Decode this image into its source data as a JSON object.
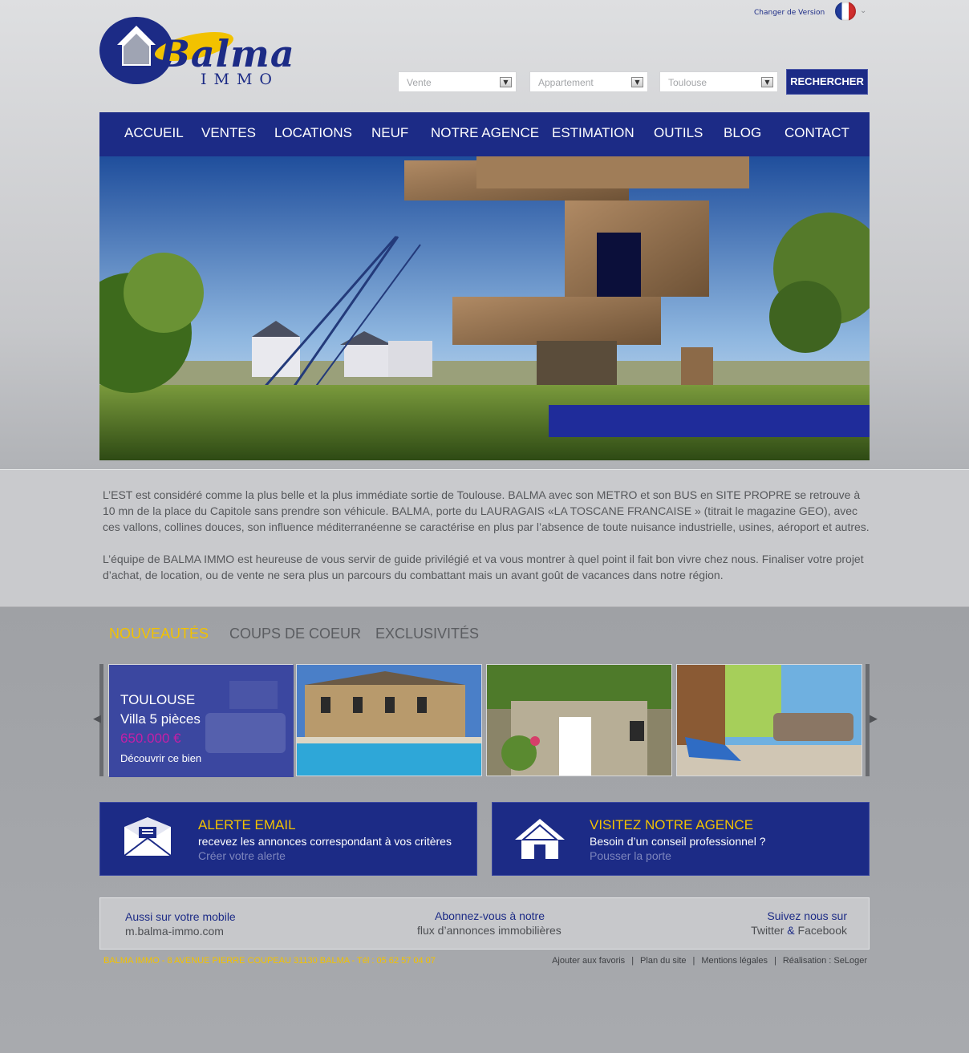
{
  "header": {
    "logo_title": "Balma",
    "logo_subtitle": "IMMO",
    "version_link": "Changer de Version"
  },
  "search": {
    "transaction": "Vente",
    "property_type": "Appartement",
    "city": "Toulouse",
    "button": "RECHERCHER"
  },
  "nav": [
    "ACCUEIL",
    "VENTES",
    "LOCATIONS",
    "NEUF",
    "NOTRE AGENCE",
    "ESTIMATION",
    "OUTILS",
    "BLOG",
    "CONTACT"
  ],
  "intro": {
    "p1": "L’EST est considéré comme la plus belle et la plus immédiate sortie de Toulouse. BALMA avec son METRO et son BUS en SITE PROPRE se retrouve à 10 mn de la place du Capitole sans prendre son véhicule. BALMA, porte du LAURAGAIS  «LA TOSCANE FRANCAISE » (titrait le magazine GEO), avec ces vallons, collines douces, son influence méditerranéenne se caractérise en plus par l’absence de toute nuisance industrielle, usines, aéroport et autres.",
    "p2": "L’équipe de BALMA IMMO est heureuse de vous servir de guide privilégié et va vous montrer à quel point il fait bon vivre chez nous. Finaliser votre projet d’achat, de location, ou de vente ne sera plus un parcours du combattant mais un avant goût de vacances dans notre région."
  },
  "tabs": [
    "NOUVEAUTÉS",
    "COUPS DE COEUR",
    "EXCLUSIVITÉS"
  ],
  "featured": {
    "city": "TOULOUSE",
    "type": "Villa 5 pièces",
    "price": "650.000 €",
    "link": "Découvrir ce bien"
  },
  "promos": {
    "alert": {
      "title": "ALERTE EMAIL",
      "line": "recevez les annonces correspondant à vos critères",
      "link": "Créer votre alerte"
    },
    "agency": {
      "title": "VISITEZ NOTRE AGENCE",
      "line": "Besoin d’un conseil professionnel ?",
      "link": "Pousser la porte"
    }
  },
  "footer": {
    "mobile_label": "Aussi sur votre mobile",
    "mobile_url": "m.balma-immo.com",
    "feed_label": "Abonnez-vous à notre",
    "feed_link": "flux d’annonces immobilières",
    "social_label": "Suivez nous sur",
    "social_twitter": "Twitter",
    "social_and": "&",
    "social_facebook": "Facebook",
    "address": "BALMA IMMO - 8 AVENUE PIERRE COUPEAU 31130 BALMA - Tél : 05 62 57 04 07",
    "links": [
      "Ajouter aux favoris",
      "Plan du site",
      "Mentions légales",
      "Réalisation : SeLoger"
    ]
  },
  "colors": {
    "brand_blue": "#1c2b86",
    "accent_yellow": "#f2c200",
    "price_magenta": "#c51fa6"
  }
}
